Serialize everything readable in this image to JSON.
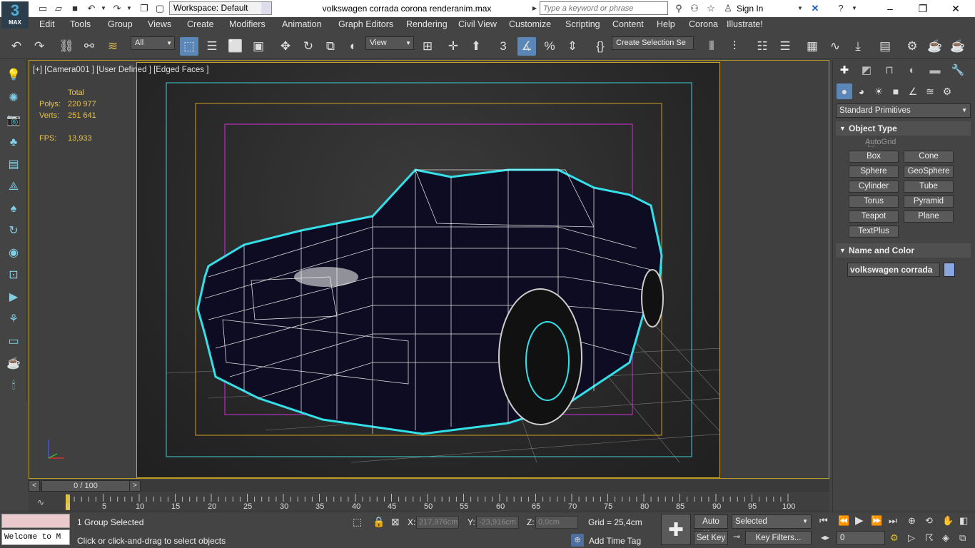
{
  "app": {
    "logo_text": "3",
    "logo_sub": "MAX"
  },
  "titlebar": {
    "workspace": "Workspace: Default",
    "document_title": "volkswagen corrada corona renderanim.max",
    "search_placeholder": "Type a keyword or phrase",
    "sign_in": "Sign In"
  },
  "menus": [
    "Edit",
    "Tools",
    "Group",
    "Views",
    "Create",
    "Modifiers",
    "Animation",
    "Graph Editors",
    "Rendering",
    "Civil View",
    "Customize",
    "Scripting",
    "Content",
    "Help",
    "Corona",
    "Illustrate!"
  ],
  "toolbar": {
    "filter": "All",
    "view": "View",
    "selection_set": "Create Selection Se"
  },
  "viewport": {
    "label": "[+] [Camera001 ] [User Defined ] [Edged Faces ]",
    "stats": {
      "total_label": "Total",
      "polys_label": "Polys:",
      "polys": "220 977",
      "verts_label": "Verts:",
      "verts": "251 641",
      "fps_label": "FPS:",
      "fps": "13,933"
    }
  },
  "timeline": {
    "frame": "0 / 100",
    "ticks": [
      "0",
      "5",
      "10",
      "15",
      "20",
      "25",
      "30",
      "35",
      "40",
      "45",
      "50",
      "55",
      "60",
      "65",
      "70",
      "75",
      "80",
      "85",
      "90",
      "95",
      "100"
    ]
  },
  "status": {
    "selection": "1 Group Selected",
    "prompt": "Click or click-and-drag to select objects",
    "maxscript_text": "Welcome to M",
    "x_label": "X:",
    "x": "217,976cm",
    "y_label": "Y:",
    "y": "-23,916cm",
    "z_label": "Z:",
    "z": "0,0cm",
    "grid": "Grid = 25,4cm",
    "add_time_tag": "Add Time Tag",
    "auto_key": "Auto Key",
    "set_key": "Set Key",
    "selected": "Selected",
    "key_filters": "Key Filters...",
    "frame_input": "0"
  },
  "command_panel": {
    "category": "Standard Primitives",
    "object_type_title": "Object Type",
    "autogrid": "AutoGrid",
    "buttons": [
      "Box",
      "Cone",
      "Sphere",
      "GeoSphere",
      "Cylinder",
      "Tube",
      "Torus",
      "Pyramid",
      "Teapot",
      "Plane",
      "TextPlus"
    ],
    "name_color_title": "Name and Color",
    "object_name": "volkswagen corrada",
    "object_color": "#89a6e0"
  },
  "colors": {
    "accent": "#5b87b8",
    "viewport_border": "#c9a227",
    "wire": "#ffffff",
    "selection": "#33e0ea"
  }
}
